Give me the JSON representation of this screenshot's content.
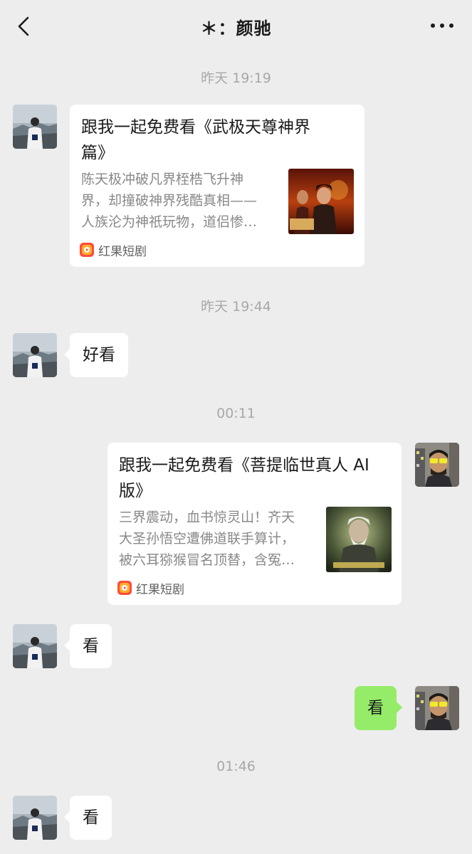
{
  "header": {
    "title": "＊：颜驰"
  },
  "timestamps": [
    "昨天 19:19",
    "昨天 19:44",
    "00:11",
    "01:46"
  ],
  "messages": [
    {
      "side": "left",
      "type": "card",
      "title_lines": [
        "跟我一起免费看《武极天尊神界",
        "篇》"
      ],
      "desc_lines": [
        "陈天极冲破凡界桎梏飞升神",
        "界，却撞破神界残酷真相——",
        "人族沦为神祇玩物，道侣惨…"
      ],
      "source": "红果短剧"
    },
    {
      "side": "left",
      "type": "text",
      "text": "好看"
    },
    {
      "side": "right",
      "type": "card",
      "title_lines": [
        "跟我一起免费看《菩提临世真人 AI",
        "版》"
      ],
      "desc_lines": [
        "三界震动，血书惊灵山！齐天",
        "大圣孙悟空遭佛道联手算计，",
        "被六耳猕猴冒名顶替，含冤…"
      ],
      "source": "红果短剧"
    },
    {
      "side": "left",
      "type": "text",
      "text": "看"
    },
    {
      "side": "right",
      "type": "text",
      "text": "看"
    },
    {
      "side": "left",
      "type": "text",
      "text": "看"
    }
  ],
  "colors": {
    "background": "#ededed",
    "bubble_self": "#95ec69",
    "bubble_other": "#ffffff",
    "timestamp": "#a8a8a8",
    "source_brand": "#ff4d3a"
  },
  "icons": [
    "back-chevron-icon",
    "more-dots-icon",
    "hongguo-logo-icon"
  ]
}
